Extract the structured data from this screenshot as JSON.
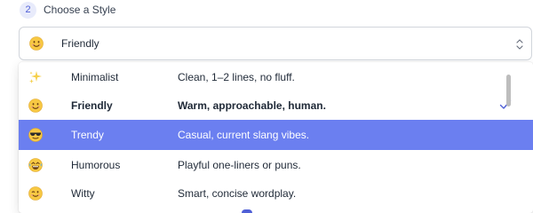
{
  "step": {
    "number": "2",
    "title": "Choose a Style"
  },
  "select": {
    "value": "Friendly",
    "icon": "smiling-face-icon"
  },
  "options": [
    {
      "icon": "sparkles-icon",
      "name": "Minimalist",
      "description": "Clean, 1–2 lines, no fluff."
    },
    {
      "icon": "smiling-face-icon",
      "name": "Friendly",
      "description": "Warm, approachable, human.",
      "selected": true
    },
    {
      "icon": "sunglasses-face-icon",
      "name": "Trendy",
      "description": "Casual, current slang vibes.",
      "highlighted": true
    },
    {
      "icon": "laughing-face-icon",
      "name": "Humorous",
      "description": "Playful one-liners or puns."
    },
    {
      "icon": "winking-face-icon",
      "name": "Witty",
      "description": "Smart, concise wordplay."
    }
  ],
  "colors": {
    "accent": "#6b7ff0",
    "badge_bg": "#e8ebfb",
    "check": "#4f5fd6"
  }
}
